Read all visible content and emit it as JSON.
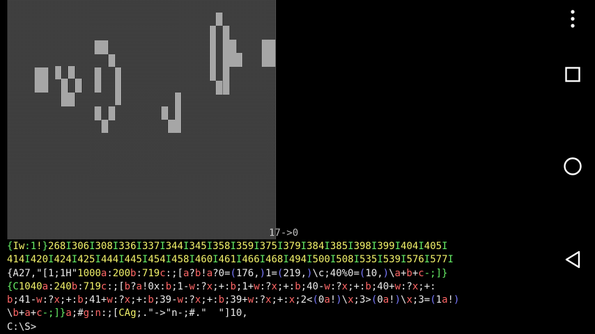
{
  "game": {
    "counter_text": "17->0"
  },
  "terminal": {
    "lines": [
      [
        {
          "t": "{",
          "c": "c-green"
        },
        {
          "t": "Iw",
          "c": "c-yellow"
        },
        {
          "t": ":1",
          "c": "c-green"
        },
        {
          "t": "!",
          "c": "c-yellow"
        },
        {
          "t": "}",
          "c": "c-green"
        },
        {
          "t": "268",
          "c": "c-yellow"
        },
        {
          "t": "I",
          "c": "c-green"
        },
        {
          "t": "306",
          "c": "c-yellow"
        },
        {
          "t": "I",
          "c": "c-green"
        },
        {
          "t": "308",
          "c": "c-yellow"
        },
        {
          "t": "I",
          "c": "c-green"
        },
        {
          "t": "336",
          "c": "c-yellow"
        },
        {
          "t": "I",
          "c": "c-green"
        },
        {
          "t": "337",
          "c": "c-yellow"
        },
        {
          "t": "I",
          "c": "c-green"
        },
        {
          "t": "344",
          "c": "c-yellow"
        },
        {
          "t": "I",
          "c": "c-green"
        },
        {
          "t": "345",
          "c": "c-yellow"
        },
        {
          "t": "I",
          "c": "c-green"
        },
        {
          "t": "358",
          "c": "c-yellow"
        },
        {
          "t": "I",
          "c": "c-green"
        },
        {
          "t": "359",
          "c": "c-yellow"
        },
        {
          "t": "I",
          "c": "c-green"
        },
        {
          "t": "375",
          "c": "c-yellow"
        },
        {
          "t": "I",
          "c": "c-green"
        },
        {
          "t": "379",
          "c": "c-yellow"
        },
        {
          "t": "I",
          "c": "c-green"
        },
        {
          "t": "384",
          "c": "c-yellow"
        },
        {
          "t": "I",
          "c": "c-green"
        },
        {
          "t": "385",
          "c": "c-yellow"
        },
        {
          "t": "I",
          "c": "c-green"
        },
        {
          "t": "398",
          "c": "c-yellow"
        },
        {
          "t": "I",
          "c": "c-green"
        },
        {
          "t": "399",
          "c": "c-yellow"
        },
        {
          "t": "I",
          "c": "c-green"
        },
        {
          "t": "404",
          "c": "c-yellow"
        },
        {
          "t": "I",
          "c": "c-green"
        },
        {
          "t": "405",
          "c": "c-yellow"
        },
        {
          "t": "I",
          "c": "c-green"
        }
      ],
      [
        {
          "t": "414",
          "c": "c-yellow"
        },
        {
          "t": "I",
          "c": "c-green"
        },
        {
          "t": "420",
          "c": "c-yellow"
        },
        {
          "t": "I",
          "c": "c-green"
        },
        {
          "t": "424",
          "c": "c-yellow"
        },
        {
          "t": "I",
          "c": "c-green"
        },
        {
          "t": "425",
          "c": "c-yellow"
        },
        {
          "t": "I",
          "c": "c-green"
        },
        {
          "t": "444",
          "c": "c-yellow"
        },
        {
          "t": "I",
          "c": "c-green"
        },
        {
          "t": "445",
          "c": "c-yellow"
        },
        {
          "t": "I",
          "c": "c-green"
        },
        {
          "t": "454",
          "c": "c-yellow"
        },
        {
          "t": "I",
          "c": "c-green"
        },
        {
          "t": "458",
          "c": "c-yellow"
        },
        {
          "t": "I",
          "c": "c-green"
        },
        {
          "t": "460",
          "c": "c-yellow"
        },
        {
          "t": "I",
          "c": "c-green"
        },
        {
          "t": "461",
          "c": "c-yellow"
        },
        {
          "t": "I",
          "c": "c-green"
        },
        {
          "t": "466",
          "c": "c-yellow"
        },
        {
          "t": "I",
          "c": "c-green"
        },
        {
          "t": "468",
          "c": "c-yellow"
        },
        {
          "t": "I",
          "c": "c-green"
        },
        {
          "t": "494",
          "c": "c-yellow"
        },
        {
          "t": "I",
          "c": "c-green"
        },
        {
          "t": "500",
          "c": "c-yellow"
        },
        {
          "t": "I",
          "c": "c-green"
        },
        {
          "t": "508",
          "c": "c-yellow"
        },
        {
          "t": "I",
          "c": "c-green"
        },
        {
          "t": "535",
          "c": "c-yellow"
        },
        {
          "t": "I",
          "c": "c-green"
        },
        {
          "t": "539",
          "c": "c-yellow"
        },
        {
          "t": "I",
          "c": "c-green"
        },
        {
          "t": "576",
          "c": "c-yellow"
        },
        {
          "t": "I",
          "c": "c-green"
        },
        {
          "t": "577",
          "c": "c-yellow"
        },
        {
          "t": "I",
          "c": "c-green"
        }
      ],
      [
        {
          "t": "{A27,\"[1;1H\"",
          "c": "c-white"
        },
        {
          "t": "1000",
          "c": "c-yellow"
        },
        {
          "t": "a",
          "c": "c-red"
        },
        {
          "t": ":",
          "c": "c-white"
        },
        {
          "t": "200",
          "c": "c-yellow"
        },
        {
          "t": "b",
          "c": "c-red"
        },
        {
          "t": ":",
          "c": "c-white"
        },
        {
          "t": "719",
          "c": "c-yellow"
        },
        {
          "t": "c",
          "c": "c-red"
        },
        {
          "t": ":;[",
          "c": "c-white"
        },
        {
          "t": "a",
          "c": "c-red"
        },
        {
          "t": "?",
          "c": "c-white"
        },
        {
          "t": "b",
          "c": "c-red"
        },
        {
          "t": "!",
          "c": "c-white"
        },
        {
          "t": "a",
          "c": "c-red"
        },
        {
          "t": "?0=",
          "c": "c-white"
        },
        {
          "t": "(",
          "c": "c-blue"
        },
        {
          "t": "176,",
          "c": "c-white"
        },
        {
          "t": ")",
          "c": "c-blue"
        },
        {
          "t": "1=",
          "c": "c-white"
        },
        {
          "t": "(",
          "c": "c-blue"
        },
        {
          "t": "219,",
          "c": "c-white"
        },
        {
          "t": ")",
          "c": "c-blue"
        },
        {
          "t": "\\c;40%0=",
          "c": "c-white"
        },
        {
          "t": "(",
          "c": "c-blue"
        },
        {
          "t": "10,",
          "c": "c-white"
        },
        {
          "t": ")",
          "c": "c-blue"
        },
        {
          "t": "\\",
          "c": "c-white"
        },
        {
          "t": "a",
          "c": "c-red"
        },
        {
          "t": "+",
          "c": "c-white"
        },
        {
          "t": "b",
          "c": "c-red"
        },
        {
          "t": "+",
          "c": "c-white"
        },
        {
          "t": "c",
          "c": "c-red"
        },
        {
          "t": "-;]}",
          "c": "c-green"
        }
      ],
      [
        {
          "t": "{C",
          "c": "c-green"
        },
        {
          "t": "1040",
          "c": "c-yellow"
        },
        {
          "t": "a",
          "c": "c-red"
        },
        {
          "t": ":",
          "c": "c-white"
        },
        {
          "t": "240",
          "c": "c-yellow"
        },
        {
          "t": "b",
          "c": "c-red"
        },
        {
          "t": ":",
          "c": "c-white"
        },
        {
          "t": "719",
          "c": "c-yellow"
        },
        {
          "t": "c",
          "c": "c-red"
        },
        {
          "t": ":;[",
          "c": "c-white"
        },
        {
          "t": "b",
          "c": "c-red"
        },
        {
          "t": "?",
          "c": "c-white"
        },
        {
          "t": "a",
          "c": "c-red"
        },
        {
          "t": "!0x:",
          "c": "c-white"
        },
        {
          "t": "b",
          "c": "c-red"
        },
        {
          "t": ";1-",
          "c": "c-white"
        },
        {
          "t": "w",
          "c": "c-red"
        },
        {
          "t": ":?",
          "c": "c-white"
        },
        {
          "t": "x",
          "c": "c-red"
        },
        {
          "t": ";+:",
          "c": "c-white"
        },
        {
          "t": "b",
          "c": "c-red"
        },
        {
          "t": ";1+",
          "c": "c-white"
        },
        {
          "t": "w",
          "c": "c-red"
        },
        {
          "t": ":?",
          "c": "c-white"
        },
        {
          "t": "x",
          "c": "c-red"
        },
        {
          "t": ";+:",
          "c": "c-white"
        },
        {
          "t": "b",
          "c": "c-red"
        },
        {
          "t": ";40-",
          "c": "c-white"
        },
        {
          "t": "w",
          "c": "c-red"
        },
        {
          "t": ":?",
          "c": "c-white"
        },
        {
          "t": "x",
          "c": "c-red"
        },
        {
          "t": ";+:",
          "c": "c-white"
        },
        {
          "t": "b",
          "c": "c-red"
        },
        {
          "t": ";40+",
          "c": "c-white"
        },
        {
          "t": "w",
          "c": "c-red"
        },
        {
          "t": ":?",
          "c": "c-white"
        },
        {
          "t": "x",
          "c": "c-red"
        },
        {
          "t": ";+:",
          "c": "c-white"
        }
      ],
      [
        {
          "t": "b",
          "c": "c-red"
        },
        {
          "t": ";41-",
          "c": "c-white"
        },
        {
          "t": "w",
          "c": "c-red"
        },
        {
          "t": ":?",
          "c": "c-white"
        },
        {
          "t": "x",
          "c": "c-red"
        },
        {
          "t": ";+:",
          "c": "c-white"
        },
        {
          "t": "b",
          "c": "c-red"
        },
        {
          "t": ";41+",
          "c": "c-white"
        },
        {
          "t": "w",
          "c": "c-red"
        },
        {
          "t": ":?",
          "c": "c-white"
        },
        {
          "t": "x",
          "c": "c-red"
        },
        {
          "t": ";+:",
          "c": "c-white"
        },
        {
          "t": "b",
          "c": "c-red"
        },
        {
          "t": ";39-",
          "c": "c-white"
        },
        {
          "t": "w",
          "c": "c-red"
        },
        {
          "t": ":?",
          "c": "c-white"
        },
        {
          "t": "x",
          "c": "c-red"
        },
        {
          "t": ";+:",
          "c": "c-white"
        },
        {
          "t": "b",
          "c": "c-red"
        },
        {
          "t": ";39+",
          "c": "c-white"
        },
        {
          "t": "w",
          "c": "c-red"
        },
        {
          "t": ":?",
          "c": "c-white"
        },
        {
          "t": "x",
          "c": "c-red"
        },
        {
          "t": ";+:",
          "c": "c-white"
        },
        {
          "t": "x",
          "c": "c-red"
        },
        {
          "t": ";2<",
          "c": "c-white"
        },
        {
          "t": "(",
          "c": "c-blue"
        },
        {
          "t": "0",
          "c": "c-white"
        },
        {
          "t": "a",
          "c": "c-red"
        },
        {
          "t": "!",
          "c": "c-white"
        },
        {
          "t": ")",
          "c": "c-blue"
        },
        {
          "t": "\\",
          "c": "c-white"
        },
        {
          "t": "x",
          "c": "c-red"
        },
        {
          "t": ";3>",
          "c": "c-white"
        },
        {
          "t": "(",
          "c": "c-blue"
        },
        {
          "t": "0",
          "c": "c-white"
        },
        {
          "t": "a",
          "c": "c-red"
        },
        {
          "t": "!",
          "c": "c-white"
        },
        {
          "t": ")",
          "c": "c-blue"
        },
        {
          "t": "\\",
          "c": "c-white"
        },
        {
          "t": "x",
          "c": "c-red"
        },
        {
          "t": ";3=",
          "c": "c-white"
        },
        {
          "t": "(",
          "c": "c-blue"
        },
        {
          "t": "1",
          "c": "c-white"
        },
        {
          "t": "a",
          "c": "c-red"
        },
        {
          "t": "!",
          "c": "c-white"
        },
        {
          "t": ")",
          "c": "c-blue"
        }
      ],
      [
        {
          "t": "\\",
          "c": "c-white"
        },
        {
          "t": "b",
          "c": "c-red"
        },
        {
          "t": "+",
          "c": "c-white"
        },
        {
          "t": "a",
          "c": "c-red"
        },
        {
          "t": "+",
          "c": "c-white"
        },
        {
          "t": "c",
          "c": "c-red"
        },
        {
          "t": "-;]}",
          "c": "c-green"
        },
        {
          "t": "a",
          "c": "c-red"
        },
        {
          "t": ";#",
          "c": "c-white"
        },
        {
          "t": "g",
          "c": "c-red"
        },
        {
          "t": ":",
          "c": "c-white"
        },
        {
          "t": "n",
          "c": "c-red"
        },
        {
          "t": ":;[",
          "c": "c-white"
        },
        {
          "t": "CAg",
          "c": "c-yellow"
        },
        {
          "t": ";.\"->\"n-;#.\"  \"]10,",
          "c": "c-white"
        }
      ],
      [
        {
          "t": "C:\\S>",
          "c": "c-white"
        }
      ]
    ]
  },
  "navbar": {
    "items": [
      {
        "name": "menu-dots-icon"
      },
      {
        "name": "recents-square-icon"
      },
      {
        "name": "home-circle-icon"
      },
      {
        "name": "back-triangle-icon"
      }
    ]
  }
}
